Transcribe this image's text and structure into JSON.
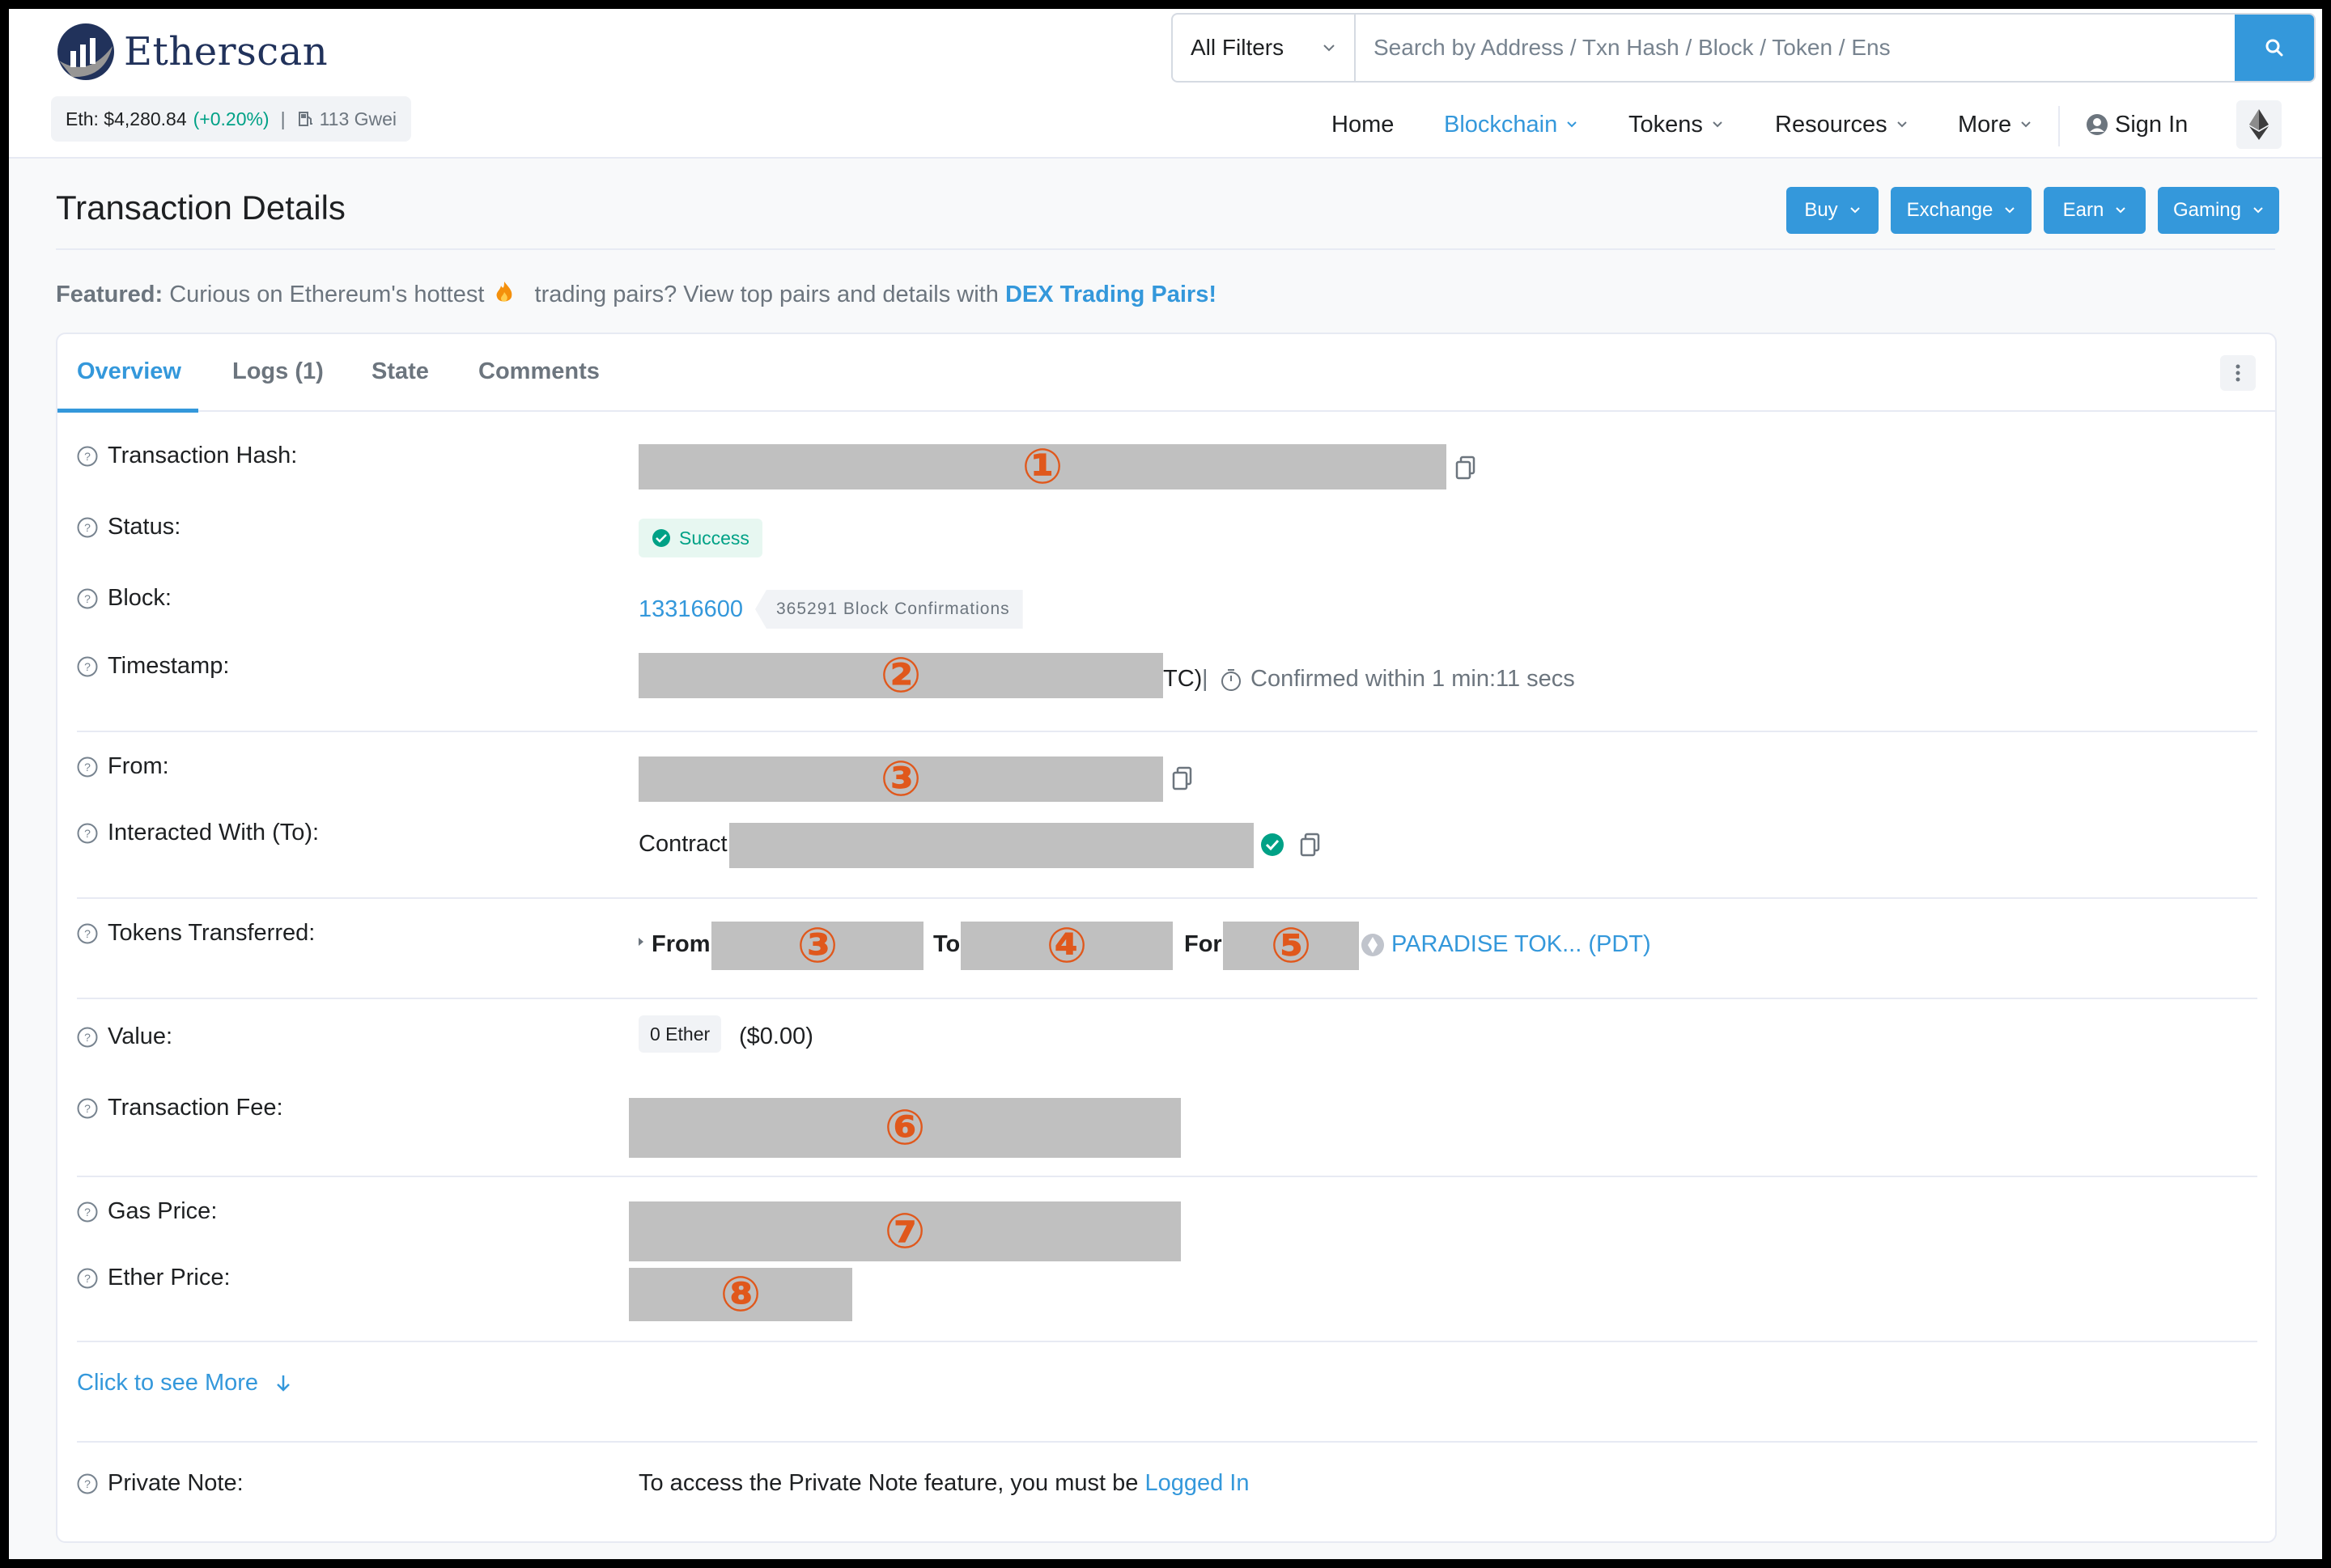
{
  "header": {
    "brand": "Etherscan",
    "price": {
      "eth_label": "Eth: $4,280.84",
      "change": "(+0.20%)",
      "separator": "|",
      "gas": "113 Gwei"
    },
    "search": {
      "filter_label": "All Filters",
      "placeholder": "Search by Address / Txn Hash / Block / Token / Ens"
    },
    "nav": {
      "home": "Home",
      "blockchain": "Blockchain",
      "tokens": "Tokens",
      "resources": "Resources",
      "more": "More",
      "sign_in": "Sign In"
    }
  },
  "page": {
    "title": "Transaction Details",
    "actions": {
      "buy": "Buy",
      "exchange": "Exchange",
      "earn": "Earn",
      "gaming": "Gaming"
    },
    "featured": {
      "label": "Featured:",
      "text1": "Curious on Ethereum's hottest",
      "text2": "trading pairs? View top pairs and details with",
      "link": "DEX Trading Pairs!"
    }
  },
  "tabs": {
    "overview": "Overview",
    "logs": "Logs (1)",
    "state": "State",
    "comments": "Comments"
  },
  "details": {
    "tx_hash": {
      "label": "Transaction Hash:",
      "marker": "①"
    },
    "status": {
      "label": "Status:",
      "value": "Success"
    },
    "block": {
      "label": "Block:",
      "number": "13316600",
      "confirmations": "365291 Block Confirmations"
    },
    "timestamp": {
      "label": "Timestamp:",
      "marker": "②",
      "tail": "TC)",
      "sep": "|",
      "confirmed": "Confirmed within 1 min:11 secs"
    },
    "from": {
      "label": "From:",
      "marker": "③"
    },
    "to": {
      "label": "Interacted With (To):",
      "prefix": "Contract"
    },
    "tokens": {
      "label": "Tokens Transferred:",
      "from": "From",
      "from_marker": "③",
      "to": "To",
      "to_marker": "④",
      "for": "For",
      "for_marker": "⑤",
      "token": "PARADISE TOK... (PDT)"
    },
    "value": {
      "label": "Value:",
      "amount": "0 Ether",
      "usd": "($0.00)"
    },
    "fee": {
      "label": "Transaction Fee:",
      "marker": "⑥"
    },
    "gas_price": {
      "label": "Gas Price:",
      "marker": "⑦"
    },
    "ether_price": {
      "label": "Ether Price:",
      "marker": "⑧"
    },
    "see_more": "Click to see More",
    "private_note": {
      "label": "Private Note:",
      "text": "To access the Private Note feature, you must be",
      "link": "Logged In"
    }
  },
  "colors": {
    "accent": "#3498db",
    "success": "#00a186",
    "redaction": "#c0c0c0",
    "marker": "#e0581c"
  }
}
